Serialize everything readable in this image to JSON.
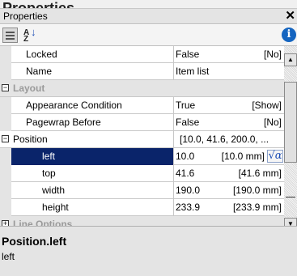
{
  "title_bar": {
    "text": "Properties"
  },
  "panel": {
    "title": "Properties",
    "close_glyph": "✕"
  },
  "toolbar": {
    "categorized_icon": "categorized-view-icon",
    "alphabetical_icon": "sort-alphabetical-icon",
    "alpha_top": "A",
    "alpha_bottom": "Z",
    "alpha_arrow": "↓",
    "info_glyph": "i"
  },
  "rows": [
    {
      "name": "Locked",
      "value": "False",
      "display": "[No]"
    },
    {
      "name": "Name",
      "value": "Item list",
      "display": ""
    },
    {
      "category": "Layout",
      "expanded": true
    },
    {
      "name": "Appearance Condition",
      "value": "True",
      "display": "[Show]"
    },
    {
      "name": "Pagewrap Before",
      "value": "False",
      "display": "[No]"
    },
    {
      "name": "Position",
      "value": "[10.0, 41.6, 200.0, ...",
      "display": "",
      "expanded": true
    },
    {
      "name": "left",
      "value": "10.0",
      "display": "[10.0 mm]",
      "selected": true
    },
    {
      "name": "top",
      "value": "41.6",
      "display": "[41.6 mm]"
    },
    {
      "name": "width",
      "value": "190.0",
      "display": "[190.0 mm]"
    },
    {
      "name": "height",
      "value": "233.9",
      "display": "[233.9 mm]"
    },
    {
      "category": "Line Options",
      "expanded": false
    }
  ],
  "description": {
    "title": "Position.left",
    "text": "left"
  },
  "colors": {
    "selection": "#0a246a",
    "category_text": "#9a9a9a",
    "info": "#1565c0"
  }
}
